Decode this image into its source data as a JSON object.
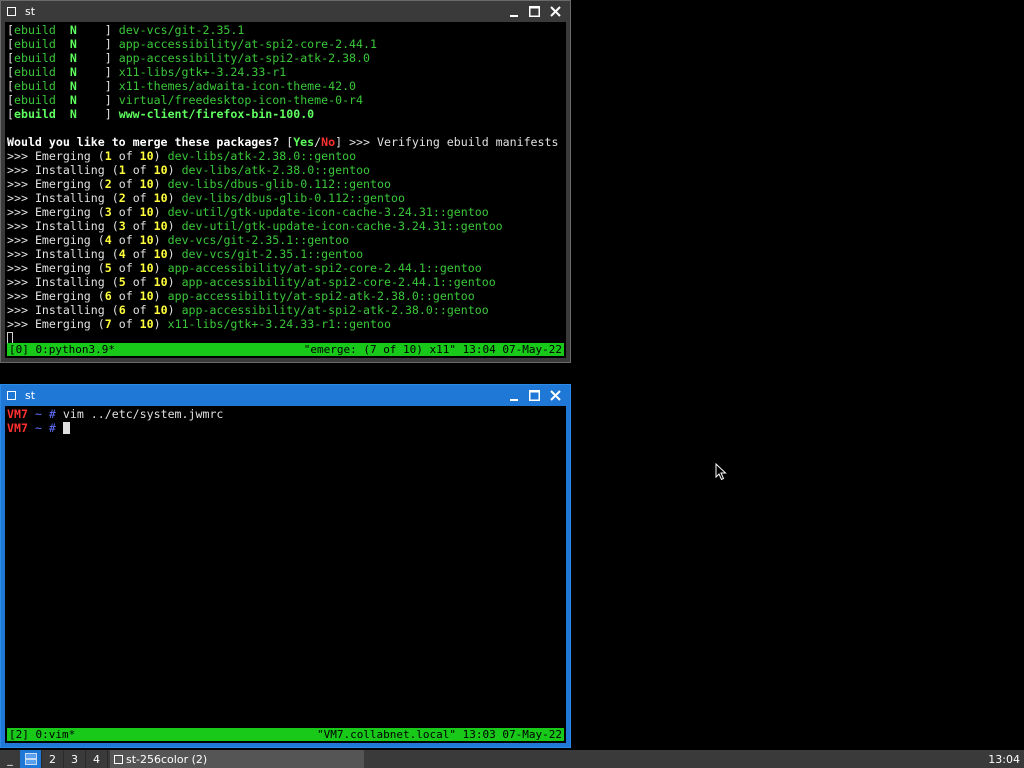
{
  "top_window": {
    "title": "st",
    "buttons": {
      "minimize": "_",
      "maximize": "□",
      "close": "×"
    },
    "ebuild_lines": [
      {
        "tag": "ebuild",
        "flag": "N",
        "pkg": "dev-vcs/git-2.35.1"
      },
      {
        "tag": "ebuild",
        "flag": "N",
        "pkg": "app-accessibility/at-spi2-core-2.44.1"
      },
      {
        "tag": "ebuild",
        "flag": "N",
        "pkg": "app-accessibility/at-spi2-atk-2.38.0"
      },
      {
        "tag": "ebuild",
        "flag": "N",
        "pkg": "x11-libs/gtk+-3.24.33-r1"
      },
      {
        "tag": "ebuild",
        "flag": "N",
        "pkg": "x11-themes/adwaita-icon-theme-42.0"
      },
      {
        "tag": "ebuild",
        "flag": "N",
        "pkg": "virtual/freedesktop-icon-theme-0-r4"
      },
      {
        "tag": "ebuild",
        "flag": "N",
        "pkg": "www-client/firefox-bin-100.0"
      }
    ],
    "prompt": {
      "question": "Would you like to merge these packages?",
      "open": "[",
      "yes": "Yes",
      "slash": "/",
      "no": "No",
      "close": "]",
      "after": ">>> Verifying ebuild manifests"
    },
    "merge_lines": [
      {
        "prefix": ">>>",
        "action": "Emerging",
        "n": "1",
        "of": "of",
        "total": "10",
        "pkg": "dev-libs/atk-2.38.0::gentoo"
      },
      {
        "prefix": ">>>",
        "action": "Installing",
        "n": "1",
        "of": "of",
        "total": "10",
        "pkg": "dev-libs/atk-2.38.0::gentoo"
      },
      {
        "prefix": ">>>",
        "action": "Emerging",
        "n": "2",
        "of": "of",
        "total": "10",
        "pkg": "dev-libs/dbus-glib-0.112::gentoo"
      },
      {
        "prefix": ">>>",
        "action": "Installing",
        "n": "2",
        "of": "of",
        "total": "10",
        "pkg": "dev-libs/dbus-glib-0.112::gentoo"
      },
      {
        "prefix": ">>>",
        "action": "Emerging",
        "n": "3",
        "of": "of",
        "total": "10",
        "pkg": "dev-util/gtk-update-icon-cache-3.24.31::gentoo"
      },
      {
        "prefix": ">>>",
        "action": "Installing",
        "n": "3",
        "of": "of",
        "total": "10",
        "pkg": "dev-util/gtk-update-icon-cache-3.24.31::gentoo"
      },
      {
        "prefix": ">>>",
        "action": "Emerging",
        "n": "4",
        "of": "of",
        "total": "10",
        "pkg": "dev-vcs/git-2.35.1::gentoo"
      },
      {
        "prefix": ">>>",
        "action": "Installing",
        "n": "4",
        "of": "of",
        "total": "10",
        "pkg": "dev-vcs/git-2.35.1::gentoo"
      },
      {
        "prefix": ">>>",
        "action": "Emerging",
        "n": "5",
        "of": "of",
        "total": "10",
        "pkg": "app-accessibility/at-spi2-core-2.44.1::gentoo"
      },
      {
        "prefix": ">>>",
        "action": "Installing",
        "n": "5",
        "of": "of",
        "total": "10",
        "pkg": "app-accessibility/at-spi2-core-2.44.1::gentoo"
      },
      {
        "prefix": ">>>",
        "action": "Emerging",
        "n": "6",
        "of": "of",
        "total": "10",
        "pkg": "app-accessibility/at-spi2-atk-2.38.0::gentoo"
      },
      {
        "prefix": ">>>",
        "action": "Installing",
        "n": "6",
        "of": "of",
        "total": "10",
        "pkg": "app-accessibility/at-spi2-atk-2.38.0::gentoo"
      },
      {
        "prefix": ">>>",
        "action": "Emerging",
        "n": "7",
        "of": "of",
        "total": "10",
        "pkg": "x11-libs/gtk+-3.24.33-r1::gentoo"
      }
    ],
    "status_left": "[0] 0:python3.9*",
    "status_right": "\"emerge: (7 of 10) x11\" 13:04 07-May-22"
  },
  "bottom_window": {
    "title": "st",
    "buttons": {
      "minimize": "_",
      "maximize": "□",
      "close": "×"
    },
    "prompt_lines": [
      {
        "host": "VM7",
        "cwd": "~",
        "sign": "#",
        "cmd": "vim ../etc/system.jwmrc"
      },
      {
        "host": "VM7",
        "cwd": "~",
        "sign": "#",
        "cmd": ""
      }
    ],
    "status_left": "[2] 0:vim*",
    "status_right": "\"VM7.collabnet.local\" 13:03 07-May-22"
  },
  "taskbar": {
    "menu_label": "_",
    "desktops": [
      "1",
      "2",
      "3",
      "4"
    ],
    "active_desktop": "1",
    "task_label": "st-256color (2)",
    "clock": "13:04"
  },
  "colors": {
    "terminal_bg": "#000000",
    "status_green": "#19c919",
    "active_title_blue": "#1f78d6",
    "inactive_title_gray": "#3a3a3a",
    "package_green": "#3ac83a",
    "number_yellow": "#ffff3c",
    "prompt_red": "#ff3030",
    "prompt_blue": "#6070ff"
  },
  "icons": {
    "window": "window-icon",
    "minimize": "minimize-icon",
    "maximize": "maximize-icon",
    "close": "close-icon",
    "pointer": "mouse-pointer-icon"
  }
}
